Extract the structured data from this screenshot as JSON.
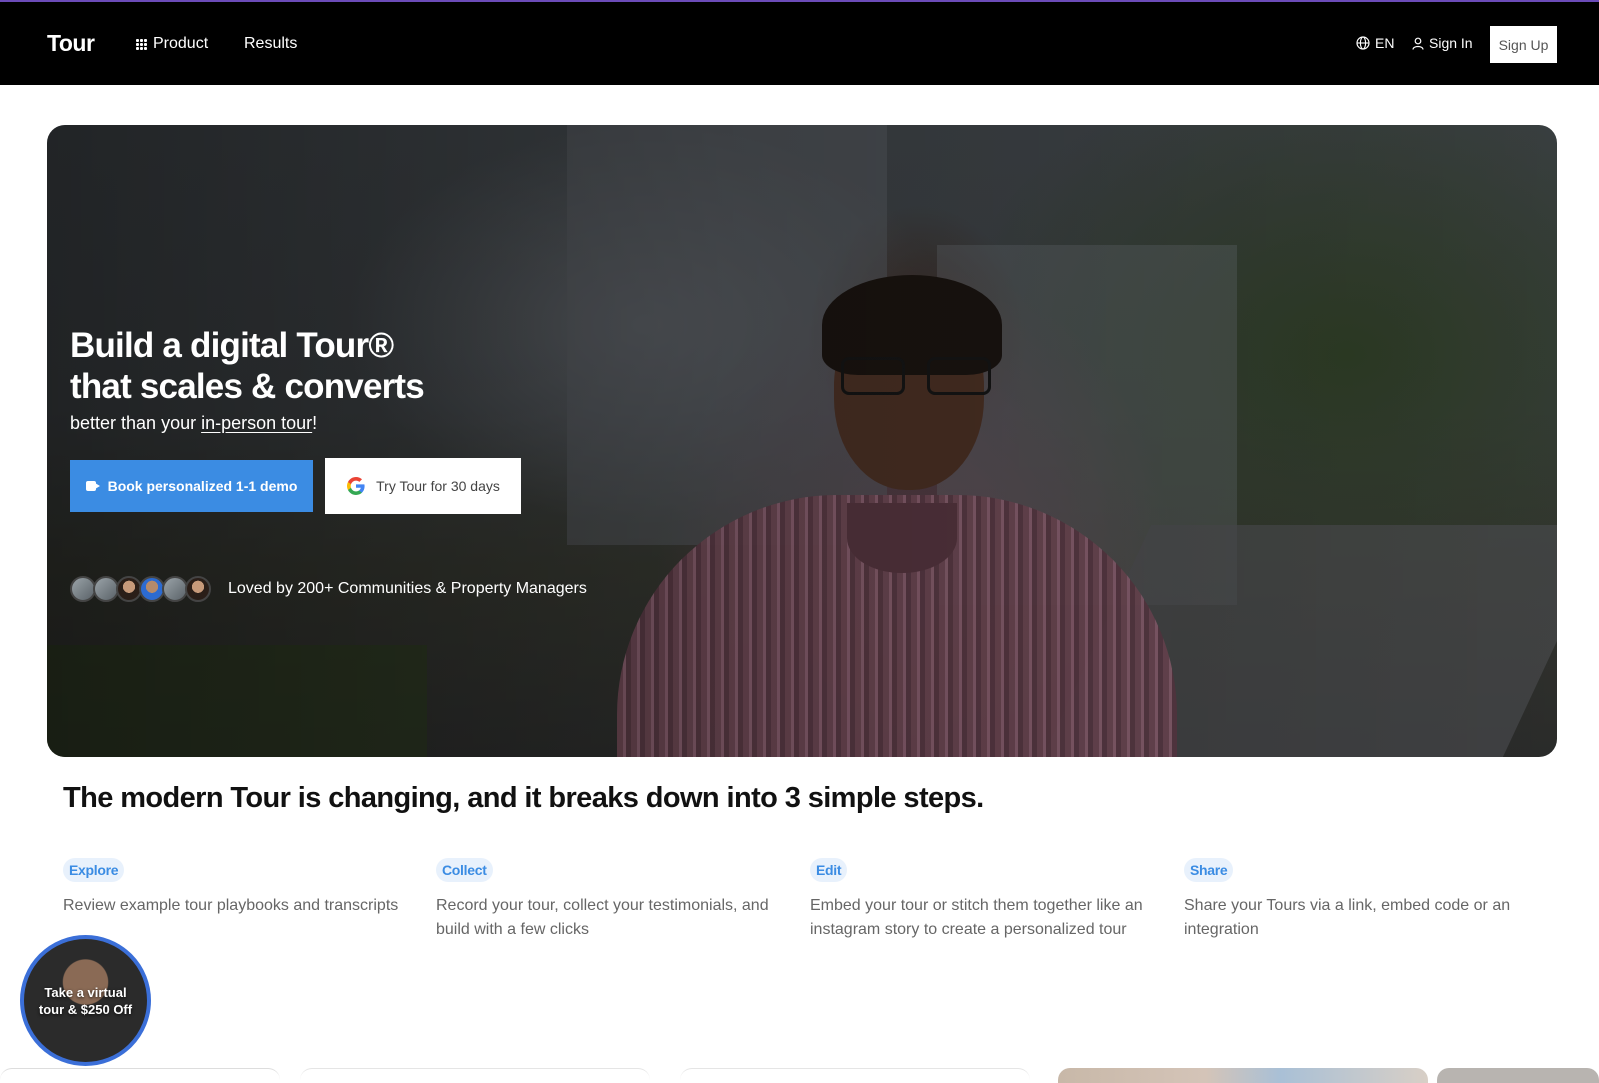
{
  "nav": {
    "brand": "Tour",
    "product_label": "Product",
    "results_label": "Results",
    "lang_label": "EN",
    "signin_label": "Sign In",
    "signup_label": "Sign Up"
  },
  "hero": {
    "title_line1": "Build a digital Tour®",
    "title_line2": "that scales & converts",
    "subtitle_prefix": "better than your ",
    "subtitle_link": "in-person tour",
    "subtitle_suffix": "!",
    "demo_button": "Book personalized 1-1 demo",
    "try_button": "Try Tour for 30 days",
    "social_proof": "Loved by 200+ Communities & Property Managers"
  },
  "steps": {
    "title": "The modern Tour is changing, and it breaks down into 3 simple steps.",
    "items": [
      {
        "badge": "Explore",
        "text": "Review example tour playbooks and transcripts"
      },
      {
        "badge": "Collect",
        "text": "Record your tour, collect your testimonials, and build with a few clicks"
      },
      {
        "badge": "Edit",
        "text": "Embed your tour or stitch them together like an instagram story to create a personalized tour"
      },
      {
        "badge": "Share",
        "text": "Share your Tours via a link, embed code or an integration"
      }
    ]
  },
  "bubble": {
    "text": "Take a virtual tour & $250 Off"
  },
  "colors": {
    "accent": "#3b8ce3",
    "nav_bg": "#000000",
    "badge_bg": "#e8f1fc"
  },
  "icons": [
    "grid-icon",
    "globe-icon",
    "user-icon",
    "video-camera-icon",
    "google-icon"
  ]
}
